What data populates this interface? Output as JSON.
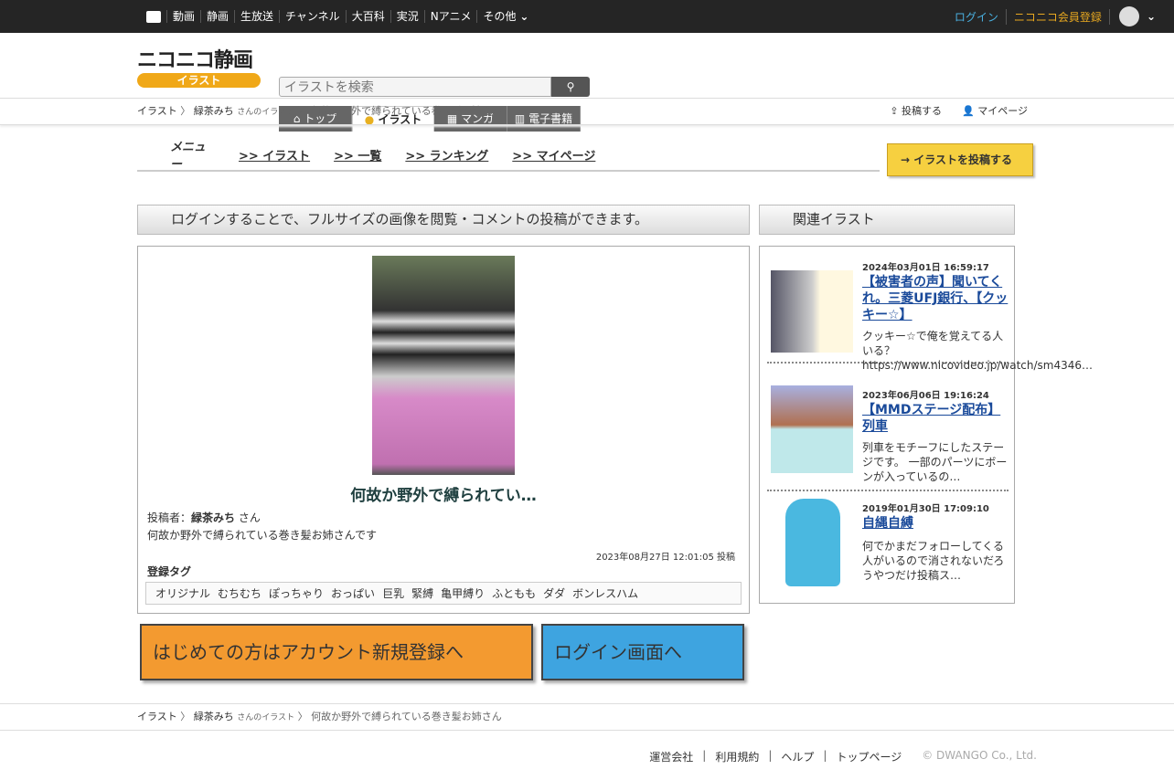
{
  "topbar": {
    "nav": [
      "動画",
      "静画",
      "生放送",
      "チャンネル",
      "大百科",
      "実況",
      "Nアニメ",
      "その他"
    ],
    "login": "ログイン",
    "register": "ニコニコ会員登録"
  },
  "header": {
    "logo_text": "ニコニコ静画",
    "logo_badge": "イラスト",
    "search_placeholder": "イラストを検索",
    "tabs": [
      "トップ",
      "イラスト",
      "マンガ",
      "電子書籍"
    ]
  },
  "breadcrumb": {
    "items": [
      "イラスト",
      "緑茶みち",
      "さんのイラスト",
      "何故か野外で縛られている巻き髪お姉さん"
    ],
    "post": "投稿する",
    "mypage": "マイページ"
  },
  "menu": {
    "label": "メニュー",
    "links": [
      ">> イラスト",
      ">> 一覧",
      ">> ランキング",
      ">> マイページ"
    ],
    "post_button": "イラストを投稿する"
  },
  "notice": "ログインすることで、フルサイズの画像を閲覧・コメントの投稿ができます。",
  "related_title": "関連イラスト",
  "illust": {
    "title": "何故か野外で縛られてい…",
    "poster_label": "投稿者：",
    "poster": "緑茶みち",
    "poster_suffix": " さん",
    "description": "何故か野外で縛られている巻き髪お姉さんです",
    "date": "2023年08月27日 12:01:05 投稿",
    "tags_label": "登録タグ",
    "tags": [
      "オリジナル",
      "むちむち",
      "ぽっちゃり",
      "おっぱい",
      "巨乳",
      "緊縛",
      "亀甲縛り",
      "ふともも",
      "ダダ",
      "ボンレスハム"
    ]
  },
  "cta": {
    "register": "はじめての方はアカウント新規登録へ",
    "login": "ログイン画面へ"
  },
  "related": [
    {
      "date": "2024年03月01日 16:59:17",
      "title": "【被害者の声】聞いてくれ。三菱UFJ銀行、【クッキー☆】",
      "desc": "クッキー☆で俺を覚えてる人いる？ https://www.nicovideo.jp/watch/sm4346…"
    },
    {
      "date": "2023年06月06日 19:16:24",
      "title": "【MMDステージ配布】列車",
      "desc": "列車をモチーフにしたステージです。 一部のパーツにボーンが入っているの…"
    },
    {
      "date": "2019年01月30日 17:09:10",
      "title": "自縄自縛",
      "desc": "何でかまだフォローしてくる人がいるので消されないだろうやつだけ投稿ス…"
    }
  ],
  "footer": {
    "links": [
      "運営会社",
      "利用規約",
      "ヘルプ",
      "トップページ"
    ],
    "copyright": "© DWANGO Co., Ltd."
  }
}
